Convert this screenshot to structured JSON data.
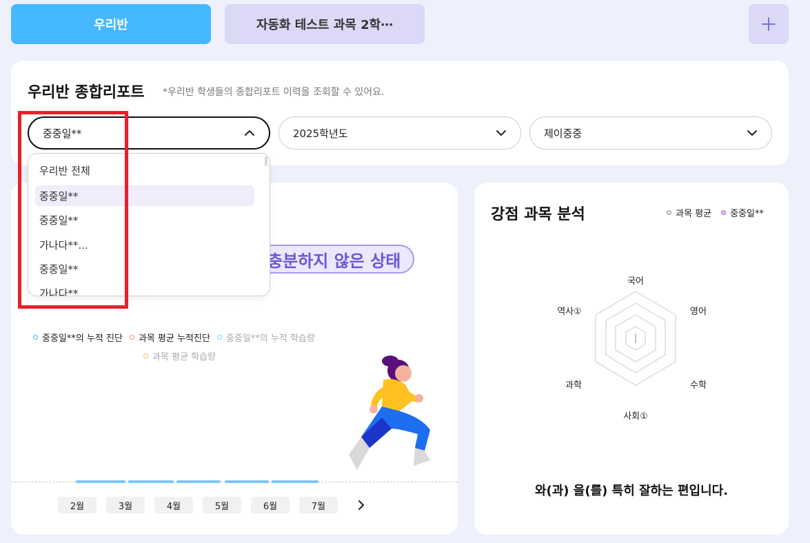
{
  "tabs": {
    "active": "우리반",
    "inactive": "자동화 테스트 과목 2학⋯",
    "add_icon": "plus-icon"
  },
  "report": {
    "title": "우리반 종합리포트",
    "subtitle": "*우리반 학생들의 종합리포트 이력을 조회할 수 있어요.",
    "student_select": "중중일**",
    "year_select": "2025학년도",
    "school_select": "제이중중"
  },
  "dropdown": {
    "items": [
      "우리반 전체",
      "중중일**",
      "중중일**",
      "가나다**...",
      "중중일**",
      "가나다**"
    ],
    "selected_index": 1
  },
  "left_panel": {
    "status": "충분하지 않은 상태",
    "legend": [
      "중중일**의 누적 진단",
      "과목 평균 누적진단",
      "중중일**의 누적 학습량",
      "과목 평균 학습량"
    ],
    "months": [
      "2월",
      "3월",
      "4월",
      "5월",
      "6월",
      "7월"
    ]
  },
  "right_panel": {
    "title": "강점 과목 분석",
    "legend": [
      "과목 평균",
      "중중일**"
    ],
    "radar_labels": [
      "국어",
      "영어",
      "수학",
      "사회①",
      "과학",
      "역사①"
    ],
    "summary": "와(과) 을(를) 특히 잘하는 편입니다."
  },
  "colors": {
    "accent": "#45b8ff",
    "tab_inactive": "#dcd9f7",
    "status_purple": "#6a56d8",
    "highlight": "#e8202a"
  }
}
